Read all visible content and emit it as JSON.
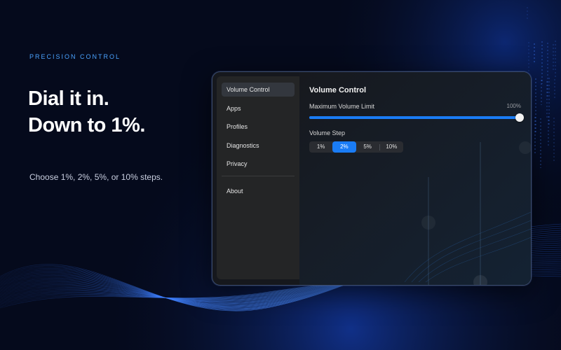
{
  "hero": {
    "eyebrow": "PRECISION CONTROL",
    "headline_line1": "Dial it in.",
    "headline_line2": "Down to 1%.",
    "subtext": "Choose 1%, 2%, 5%, or 10% steps."
  },
  "sidebar": {
    "items": [
      {
        "label": "Volume Control",
        "selected": true
      },
      {
        "label": "Apps",
        "selected": false
      },
      {
        "label": "Profiles",
        "selected": false
      },
      {
        "label": "Diagnostics",
        "selected": false
      },
      {
        "label": "Privacy",
        "selected": false
      }
    ],
    "footer_items": [
      {
        "label": "About"
      }
    ]
  },
  "panel": {
    "title": "Volume Control",
    "max_volume": {
      "label": "Maximum Volume Limit",
      "value_text": "100%",
      "value_percent": 100
    },
    "volume_step": {
      "label": "Volume Step",
      "options": [
        "1%",
        "2%",
        "5%",
        "10%"
      ],
      "selected": "2%"
    }
  },
  "colors": {
    "accent": "#1a7cf5",
    "eyebrow": "#4aa3ff",
    "background": "#050a1c"
  }
}
